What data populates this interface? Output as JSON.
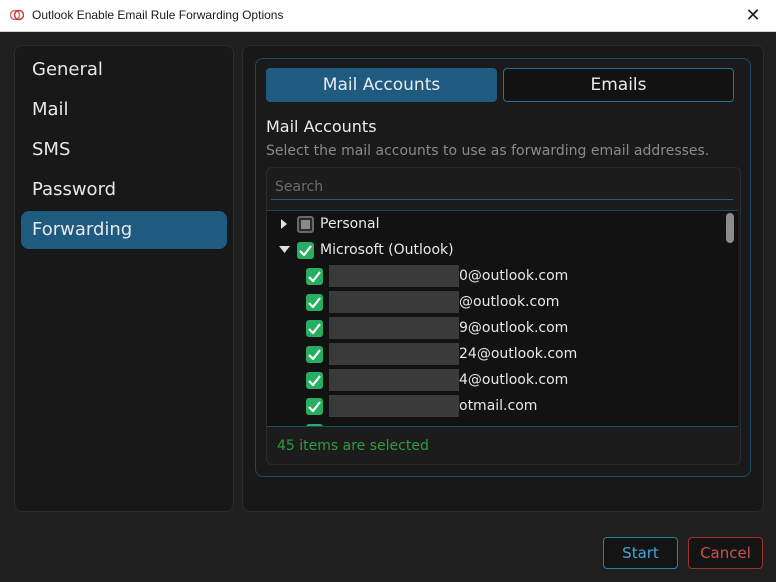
{
  "window": {
    "title": "Outlook Enable Email Rule Forwarding Options",
    "close_glyph": "✕"
  },
  "sidebar": {
    "items": [
      {
        "label": "General",
        "active": false
      },
      {
        "label": "Mail",
        "active": false
      },
      {
        "label": "SMS",
        "active": false
      },
      {
        "label": "Password",
        "active": false
      },
      {
        "label": "Forwarding",
        "active": true
      }
    ]
  },
  "tabs": {
    "mail_accounts": "Mail Accounts",
    "emails": "Emails",
    "active": "mail_accounts"
  },
  "section": {
    "title": "Mail Accounts",
    "description": "Select the mail accounts to use as forwarding email addresses."
  },
  "search": {
    "placeholder": "Search",
    "value": ""
  },
  "tree": {
    "groups": [
      {
        "label": "Personal",
        "expanded": false,
        "state": "partial"
      },
      {
        "label": "Microsoft (Outlook)",
        "expanded": true,
        "state": "checked"
      }
    ],
    "accounts": [
      {
        "visible_text": "0@outlook.com",
        "checked": true,
        "redacted_prefix": true
      },
      {
        "visible_text": "@outlook.com",
        "checked": true,
        "redacted_prefix": true
      },
      {
        "visible_text": "9@outlook.com",
        "checked": true,
        "redacted_prefix": true
      },
      {
        "visible_text": "24@outlook.com",
        "checked": true,
        "redacted_prefix": true
      },
      {
        "visible_text": "4@outlook.com",
        "checked": true,
        "redacted_prefix": true
      },
      {
        "visible_text": "otmail.com",
        "checked": true,
        "redacted_prefix": true
      }
    ]
  },
  "status": {
    "text": "45 items are selected",
    "color": "#2e9e3a"
  },
  "footer": {
    "start_label": "Start",
    "cancel_label": "Cancel"
  },
  "colors": {
    "accent": "#1f5a80",
    "checkbox": "#27ae60",
    "cancel": "#d05050",
    "start": "#3ea6d8"
  }
}
